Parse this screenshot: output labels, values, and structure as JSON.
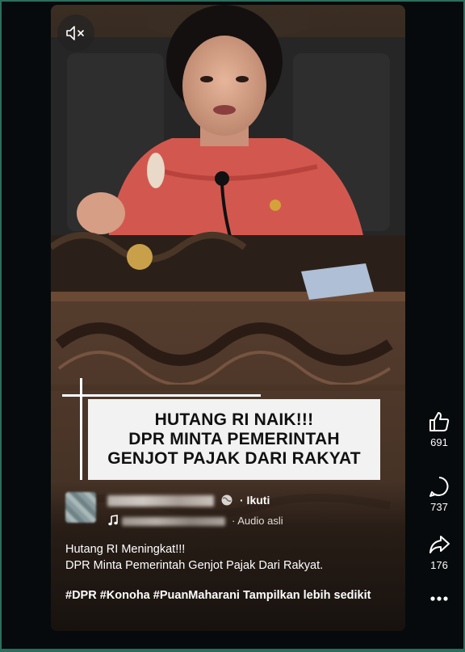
{
  "video": {
    "headline_lines": [
      "HUTANG RI NAIK!!!",
      "DPR MINTA PEMERINTAH",
      "GENJOT PAJAK DARI RAKYAT"
    ]
  },
  "author": {
    "follow_label": "· Ikuti",
    "audio_label": "· Audio asli"
  },
  "caption": {
    "lines": [
      "Hutang RI Meningkat!!!",
      "DPR Minta Pemerintah Genjot Pajak Dari Rakyat."
    ],
    "hashtags": [
      "#DPR",
      "#Konoha",
      "#PuanMaharani"
    ],
    "more_label": "Tampilkan lebih sedikit"
  },
  "actions": {
    "like_count": "691",
    "comment_count": "737",
    "share_count": "176"
  },
  "icons": {
    "mute": "speaker-muted-icon",
    "globe": "globe-icon",
    "music": "music-note-icon",
    "like": "thumbs-up-icon",
    "comment": "comment-icon",
    "share": "share-icon",
    "more": "more-dots-icon"
  },
  "colors": {
    "page_background": "#060a0c",
    "frame_accent": "#2a6e5e",
    "headline_box": "#f2f2f2",
    "text": "#ffffff"
  }
}
